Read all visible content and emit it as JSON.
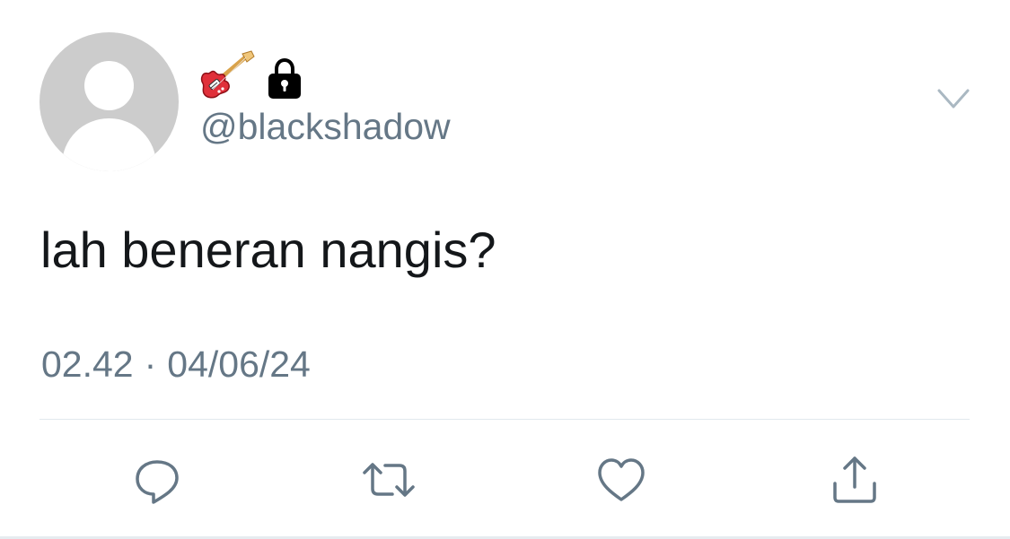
{
  "tweet": {
    "name_icons": [
      "guitar-icon",
      "lock-icon"
    ],
    "handle": "@blackshadow",
    "text": "lah beneran nangis?",
    "time": "02.42",
    "separator": "·",
    "date": "04/06/24"
  },
  "actions": [
    {
      "name": "reply",
      "icon": "reply-icon"
    },
    {
      "name": "retweet",
      "icon": "retweet-icon"
    },
    {
      "name": "like",
      "icon": "heart-icon"
    },
    {
      "name": "share",
      "icon": "share-icon"
    }
  ],
  "colors": {
    "icon_gray": "#657786",
    "text": "#14171a",
    "avatar_bg": "#cccccc",
    "divider": "#e1e8ed"
  }
}
